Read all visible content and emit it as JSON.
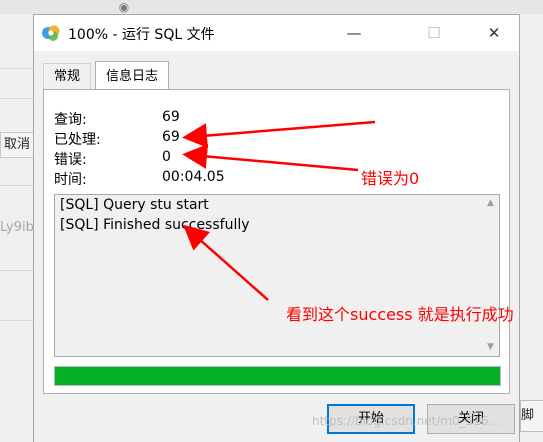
{
  "background": {
    "cancel_fragment": "取消",
    "text_fragment_1": "Ly9ib",
    "script_fragment": "脚本",
    "eye_icon": "eye-icon"
  },
  "dialog": {
    "title": "100% - 运行 SQL 文件",
    "app_icon": "navicat-icon",
    "controls": {
      "minimize": "—",
      "maximize": "☐",
      "close": "✕"
    },
    "tabs": [
      {
        "label": "常规",
        "active": false
      },
      {
        "label": "信息日志",
        "active": true
      }
    ],
    "stats": [
      {
        "label": "查询:",
        "value": "69"
      },
      {
        "label": "已处理:",
        "value": "69"
      },
      {
        "label": "错误:",
        "value": "0"
      },
      {
        "label": "时间:",
        "value": "00:04.05"
      }
    ],
    "log_lines": [
      "[SQL] Query stu start",
      "[SQL] Finished successfully"
    ],
    "progress_percent": 100,
    "progress_color": "#06b025",
    "buttons": {
      "start": "开始",
      "close": "关闭"
    }
  },
  "annotations": {
    "errors_zero": "错误为0",
    "success_note": "看到这个success  就是执行成功"
  },
  "watermark": "https://blog.csdn.net/m0_516..."
}
